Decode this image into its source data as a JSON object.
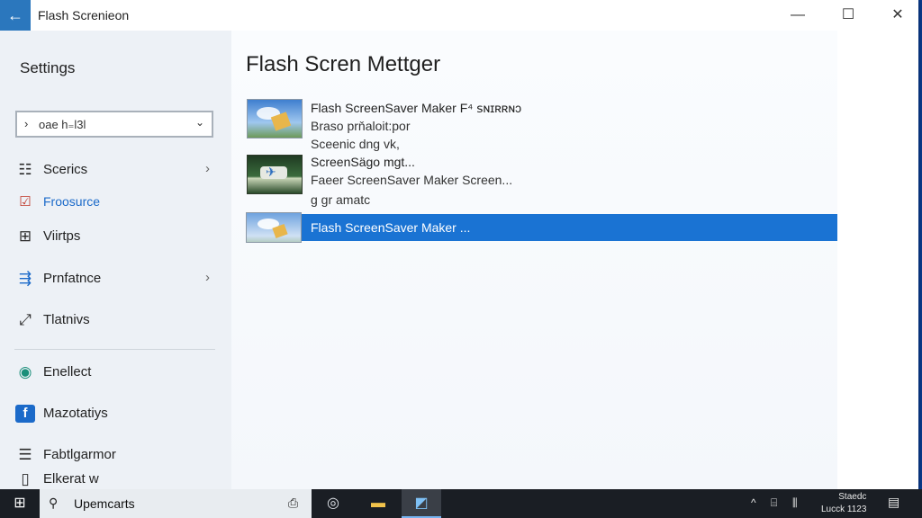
{
  "window": {
    "title": "Flash Screnieon",
    "back_glyph": "←",
    "minimize_glyph": "—",
    "maximize_glyph": "☐",
    "close_glyph": "✕"
  },
  "sidebar": {
    "title": "Settings",
    "search": {
      "value": "oae h₌l3l",
      "icon": "search-icon",
      "chevron": "⌄"
    },
    "items": [
      {
        "label": "Scerics",
        "icon": "display-icon",
        "arrow": "›"
      },
      {
        "label": "Froosurce",
        "icon": "checkbox-icon",
        "active": true
      },
      {
        "label": "Viirtps",
        "icon": "grid-icon"
      },
      {
        "label": "Prnfatnce",
        "icon": "network-icon",
        "arrow": "›"
      },
      {
        "label": "Tlatnivs",
        "icon": "expand-icon"
      },
      {
        "label": "Enellect",
        "icon": "circle-icon"
      },
      {
        "label": "Mazotatiys",
        "icon": "facebook-icon"
      },
      {
        "label": "Fabtlgarmor",
        "icon": "document-icon"
      },
      {
        "label": "Elkerat w",
        "icon": "page-icon"
      }
    ]
  },
  "main": {
    "title": "Flash Scren Mettger",
    "apps": [
      {
        "name": "Flash ScreenSaver Maker  F⁴ ꜱɴɪʀʀɴɔ",
        "line2": "Braso prňaloit:por",
        "line3": "Sceenic dng vk,"
      },
      {
        "name": "ScreenSägo mgt...",
        "line2": "Faeer ScreenSaver Maker Screen...",
        "line3": "g gr amatc"
      },
      {
        "name": "Flash ScreenSaver Maker ..."
      }
    ]
  },
  "taskbar": {
    "start_glyph": "⊞",
    "search_text": "Upemcarts",
    "mic_glyph": "🎤",
    "tray_arrow": "^",
    "tray_icons": "⊞ℍ 𝅘",
    "clock_line1": "Staedc",
    "clock_line2": "Lucck 1123",
    "notification_glyph": "▤"
  },
  "colors": {
    "accent": "#1a73d3",
    "back_button": "#2b77bd",
    "taskbar": "#1a1e24"
  }
}
